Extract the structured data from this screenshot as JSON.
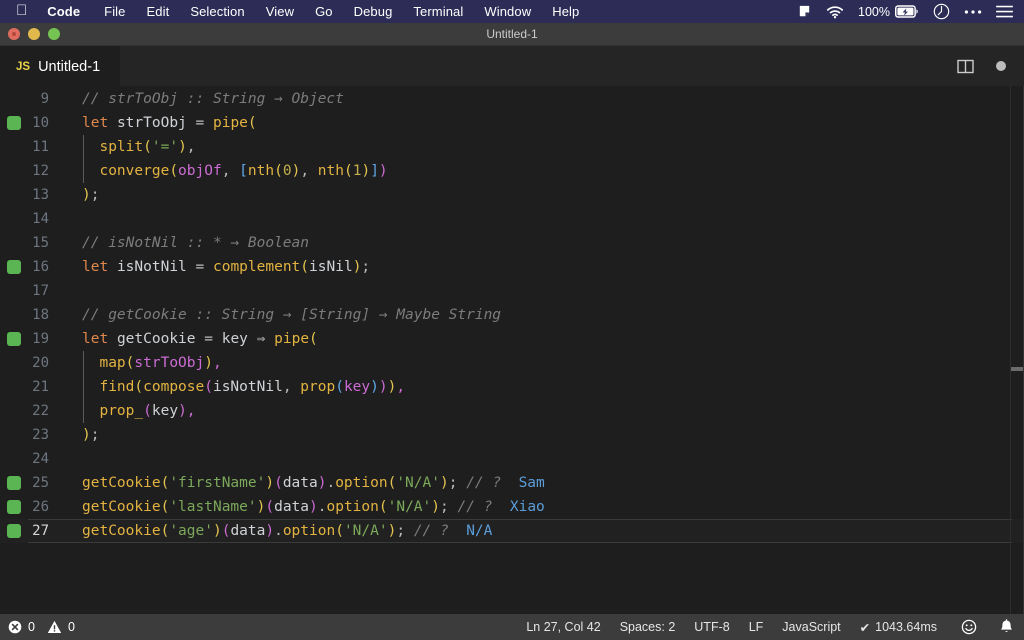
{
  "menubar": {
    "apple_icon": "apple-logo",
    "items": [
      {
        "label": "Code",
        "bold": true
      },
      {
        "label": "File",
        "bold": false
      },
      {
        "label": "Edit",
        "bold": false
      },
      {
        "label": "Selection",
        "bold": false
      },
      {
        "label": "View",
        "bold": false
      },
      {
        "label": "Go",
        "bold": false
      },
      {
        "label": "Debug",
        "bold": false
      },
      {
        "label": "Terminal",
        "bold": false
      },
      {
        "label": "Window",
        "bold": false
      },
      {
        "label": "Help",
        "bold": false
      }
    ],
    "status_icons": [
      "dropbox-icon",
      "wifi-icon",
      "battery-icon",
      "clock-icon",
      "ellipsis-icon",
      "list-icon"
    ],
    "battery_percent": "100%",
    "background": "#2c2c57"
  },
  "window": {
    "title": "Untitled-1",
    "traffic_lights": [
      "close-button",
      "minimize-button",
      "maximize-button"
    ]
  },
  "tabbar": {
    "tabs": [
      {
        "file_type": "JS",
        "label": "Untitled-1",
        "active": true
      }
    ],
    "actions": [
      "split-editor-icon",
      "unsaved-dot-icon"
    ]
  },
  "editor": {
    "language": "JavaScript",
    "first_visible_line": 9,
    "active_line": 27,
    "lines": [
      {
        "n": 9,
        "mark": false,
        "indent_guide": false
      },
      {
        "n": 10,
        "mark": true,
        "indent_guide": false
      },
      {
        "n": 11,
        "mark": false,
        "indent_guide": true
      },
      {
        "n": 12,
        "mark": false,
        "indent_guide": true
      },
      {
        "n": 13,
        "mark": false,
        "indent_guide": false
      },
      {
        "n": 14,
        "mark": false,
        "indent_guide": false
      },
      {
        "n": 15,
        "mark": false,
        "indent_guide": false
      },
      {
        "n": 16,
        "mark": true,
        "indent_guide": false
      },
      {
        "n": 17,
        "mark": false,
        "indent_guide": false
      },
      {
        "n": 18,
        "mark": false,
        "indent_guide": false
      },
      {
        "n": 19,
        "mark": true,
        "indent_guide": false
      },
      {
        "n": 20,
        "mark": false,
        "indent_guide": true
      },
      {
        "n": 21,
        "mark": false,
        "indent_guide": true
      },
      {
        "n": 22,
        "mark": false,
        "indent_guide": true
      },
      {
        "n": 23,
        "mark": false,
        "indent_guide": false
      },
      {
        "n": 24,
        "mark": false,
        "indent_guide": false
      },
      {
        "n": 25,
        "mark": true,
        "indent_guide": false
      },
      {
        "n": 26,
        "mark": true,
        "indent_guide": false
      },
      {
        "n": 27,
        "mark": true,
        "indent_guide": false
      }
    ],
    "source_text": [
      "// strToObj :: String → Object",
      "let strToObj = pipe(",
      "  split('='),",
      "  converge(objOf, [nth(0), nth(1)])",
      ");",
      "",
      "// isNotNil :: * → Boolean",
      "let isNotNil = complement(isNil);",
      "",
      "// getCookie :: String → [String] → Maybe String",
      "let getCookie = key ⇒ pipe(",
      "  map(strToObj),",
      "  find(compose(isNotNil, prop(key))),",
      "  prop_(key),",
      ");",
      "",
      "getCookie('firstName')(data).option('N/A'); // ?  Sam",
      "getCookie('lastName')(data).option('N/A'); // ?  Xiao",
      "getCookie('age')(data).option('N/A'); // ?  N/A"
    ],
    "inline_results": [
      "Sam",
      "Xiao",
      "N/A"
    ],
    "colors": {
      "background": "#1e1e1e",
      "keyword": "#e0884c",
      "function": "#e3b341",
      "string": "#7ba85a",
      "comment": "#7c7c7c",
      "number": "#c4b14a",
      "bracket_1": "#e3c44e",
      "bracket_2": "#cc6bd4",
      "bracket_3": "#5fa8e8",
      "result": "#5b9dd9",
      "breakpoint_mark": "#5ab552"
    }
  },
  "statusbar": {
    "errors_icon": "error-circle-icon",
    "errors": "0",
    "warnings_icon": "warning-triangle-icon",
    "warnings": "0",
    "cursor_position": "Ln 27, Col 42",
    "indentation": "Spaces: 2",
    "encoding": "UTF-8",
    "eol": "LF",
    "language": "JavaScript",
    "run_time": "1043.64ms",
    "run_check": "✔",
    "feedback_icon": "smiley-icon",
    "notifications_icon": "bell-icon"
  }
}
